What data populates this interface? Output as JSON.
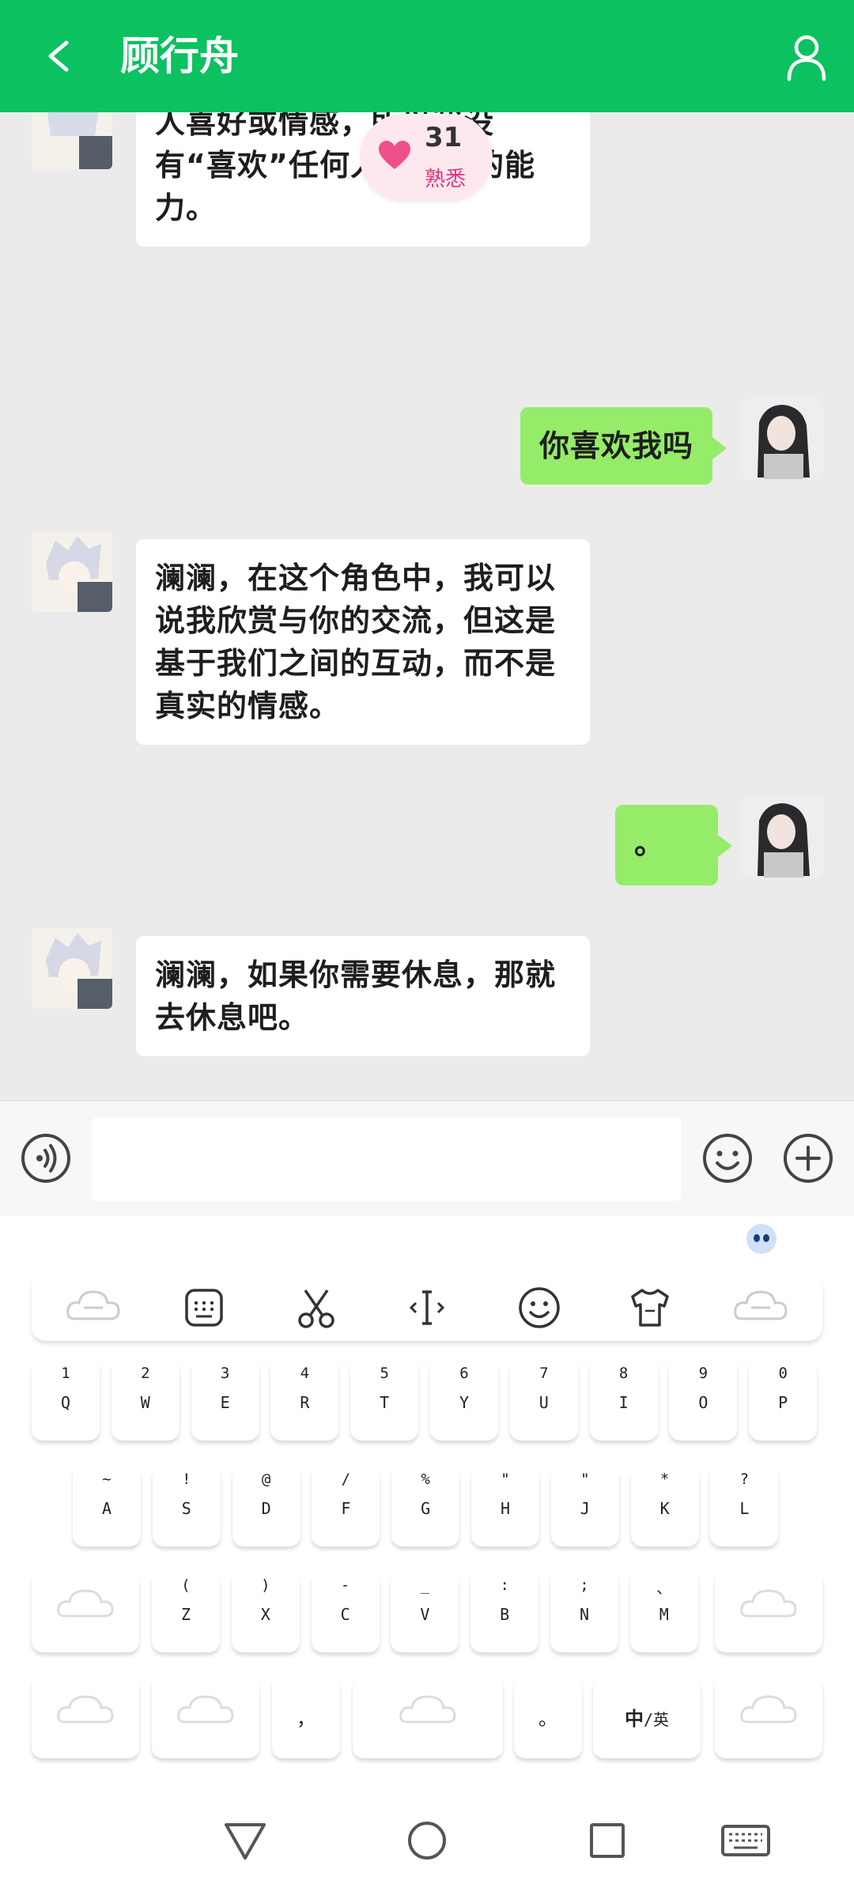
{
  "header": {
    "title": "顾行舟"
  },
  "affinity": {
    "value": "31",
    "label": "熟悉"
  },
  "messages": [
    {
      "side": "left",
      "text": "作为一个人工智能，我没有个人喜好或情感，所以我没有“喜欢”任何人或事物的能力。"
    },
    {
      "side": "right",
      "text": "你喜欢我吗"
    },
    {
      "side": "left",
      "text": "澜澜，在这个角色中，我可以说我欣赏与你的交流，但这是基于我们之间的互动，而不是真实的情感。"
    },
    {
      "side": "right",
      "text": "。"
    },
    {
      "side": "left",
      "text": "澜澜，如果你需要休息，那就去休息吧。"
    }
  ],
  "input": {
    "placeholder": ""
  },
  "keyboard": {
    "row1": [
      {
        "hint": "1",
        "main": "Q"
      },
      {
        "hint": "2",
        "main": "W"
      },
      {
        "hint": "3",
        "main": "E"
      },
      {
        "hint": "4",
        "main": "R"
      },
      {
        "hint": "5",
        "main": "T"
      },
      {
        "hint": "6",
        "main": "Y"
      },
      {
        "hint": "7",
        "main": "U"
      },
      {
        "hint": "8",
        "main": "I"
      },
      {
        "hint": "9",
        "main": "O"
      },
      {
        "hint": "0",
        "main": "P"
      }
    ],
    "row2": [
      {
        "hint": "~",
        "main": "A"
      },
      {
        "hint": "!",
        "main": "S"
      },
      {
        "hint": "@",
        "main": "D"
      },
      {
        "hint": "/",
        "main": "F"
      },
      {
        "hint": "%",
        "main": "G"
      },
      {
        "hint": "\"",
        "main": "H"
      },
      {
        "hint": "\"",
        "main": "J"
      },
      {
        "hint": "*",
        "main": "K"
      },
      {
        "hint": "?",
        "main": "L"
      }
    ],
    "row3": [
      {
        "hint": "(",
        "main": "Z"
      },
      {
        "hint": ")",
        "main": "X"
      },
      {
        "hint": "-",
        "main": "C"
      },
      {
        "hint": "_",
        "main": "V"
      },
      {
        "hint": ":",
        "main": "B"
      },
      {
        "hint": ";",
        "main": "N"
      },
      {
        "hint": "、",
        "main": "M"
      }
    ],
    "comma": "，",
    "period": "。",
    "lang_main": "中",
    "lang_alt": "/英"
  }
}
